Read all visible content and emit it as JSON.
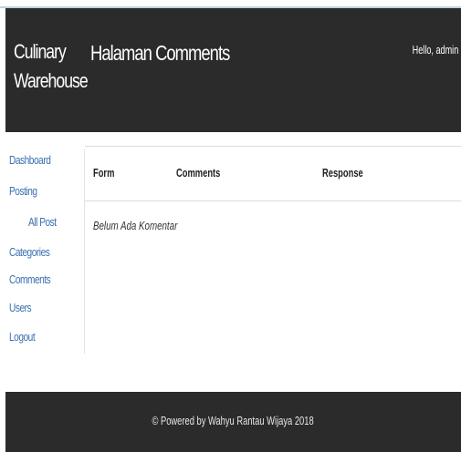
{
  "header": {
    "brand": "Culinary Warehouse",
    "title": "Halaman Comments",
    "greeting": "Hello, admin"
  },
  "sidebar": {
    "items": [
      {
        "label": "Dashboard"
      },
      {
        "label": "Posting"
      },
      {
        "label": "All Post"
      },
      {
        "label": "Categories"
      },
      {
        "label": "Comments"
      },
      {
        "label": "Users"
      },
      {
        "label": "Logout"
      }
    ]
  },
  "table": {
    "columns": [
      "Form",
      "Comments",
      "Response"
    ],
    "empty_message": "Belum Ada Komentar"
  },
  "footer": {
    "text": "© Powered by Wahyu Rantau Wijaya 2018"
  },
  "colors": {
    "header_bg": "#2b2b2b",
    "link": "#3a6fb0"
  }
}
